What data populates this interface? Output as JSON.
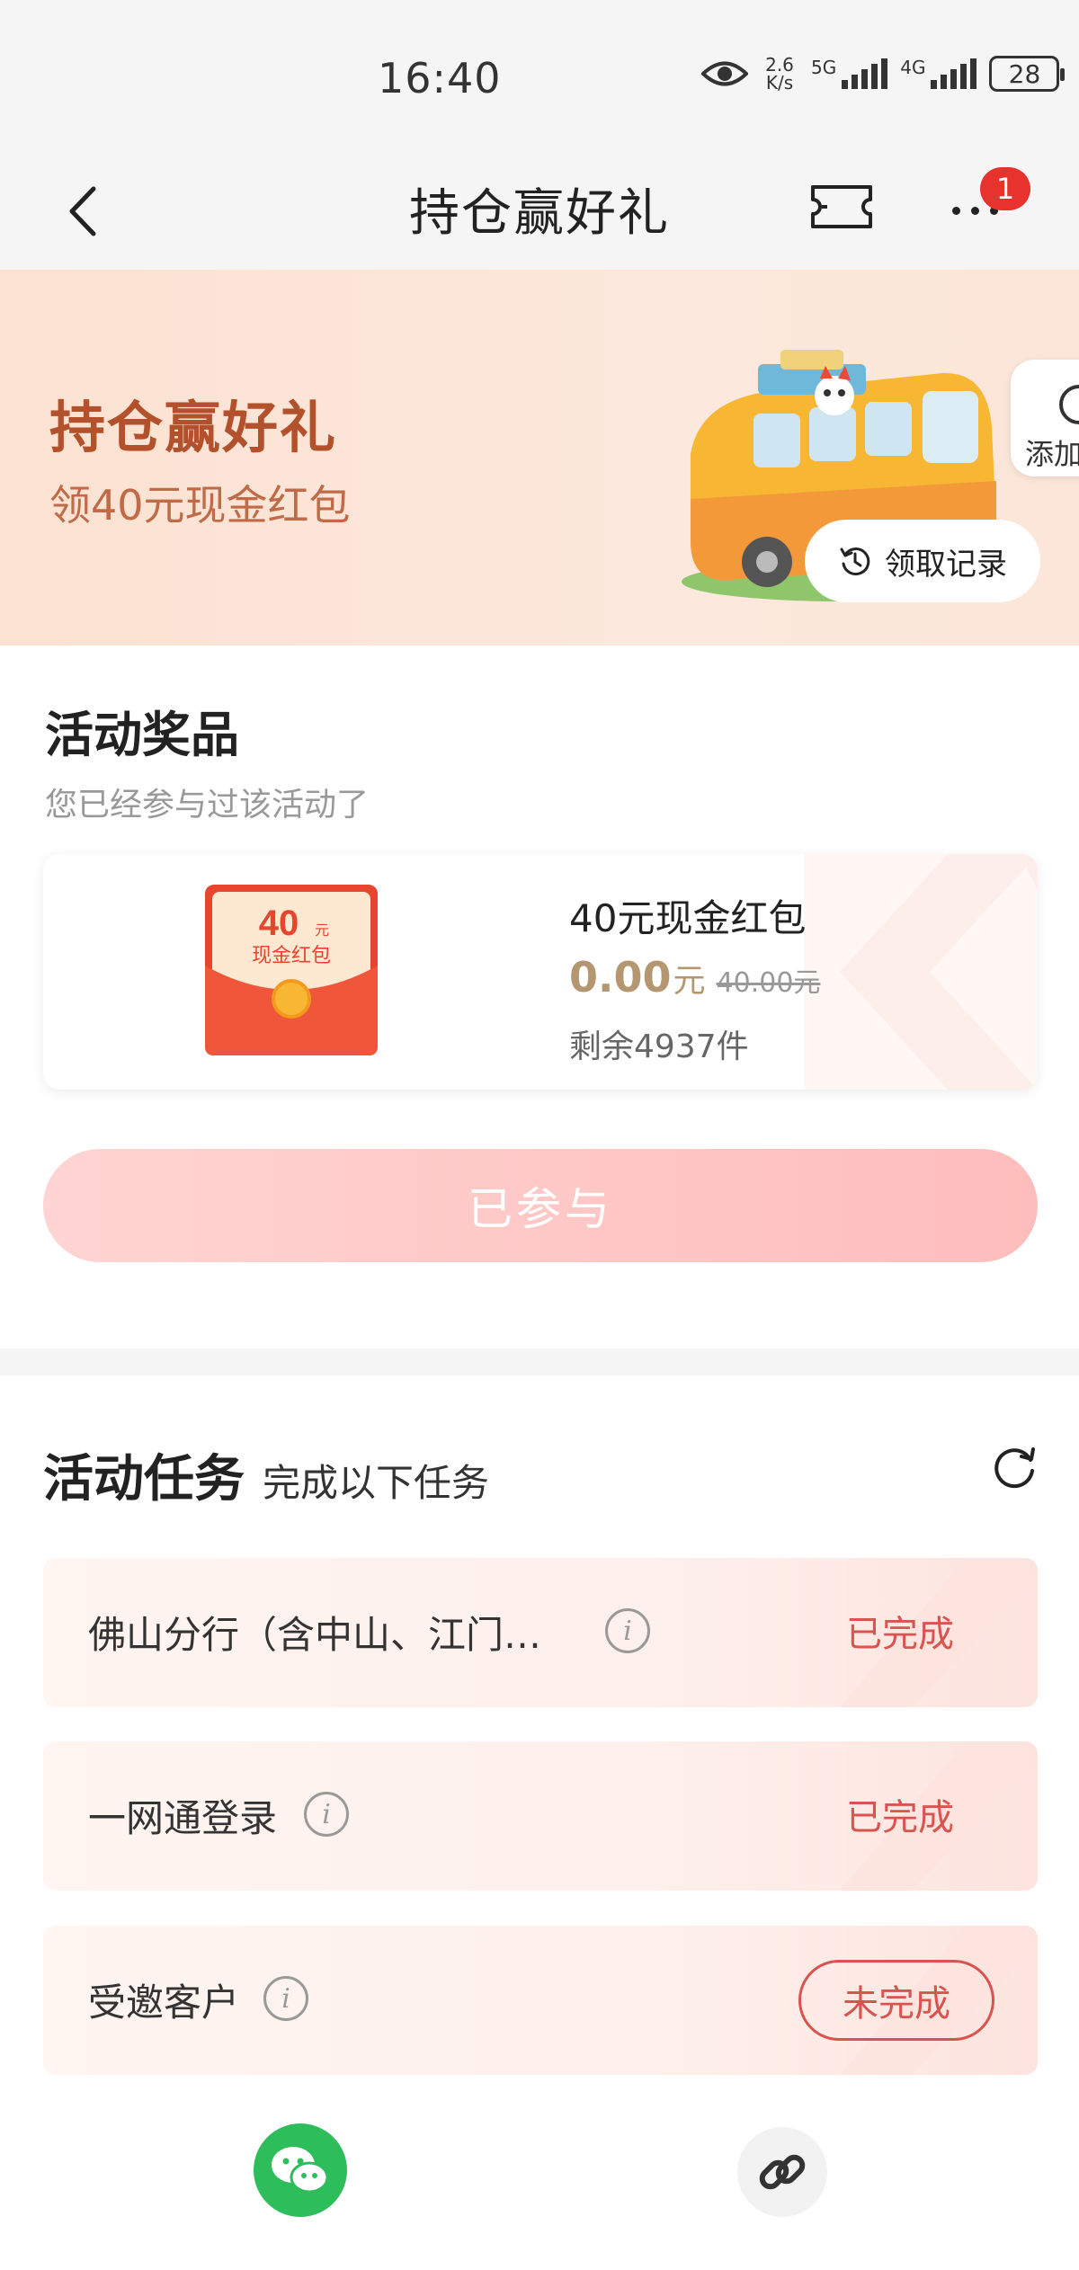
{
  "status_bar": {
    "time": "16:40",
    "net_speed_top": "2.6",
    "net_speed_bottom": "K/s",
    "signal1_label": "5G",
    "signal2_label": "4G",
    "battery": "28"
  },
  "nav": {
    "title": "持仓赢好礼",
    "badge_count": "1"
  },
  "banner": {
    "title": "持仓赢好礼",
    "subtitle": "领40元现金红包",
    "add_label": "添加",
    "record_button": "领取记录"
  },
  "prize": {
    "section_title": "活动奖品",
    "note": "您已经参与过该活动了",
    "envelope_amount": "40",
    "envelope_unit": "元",
    "envelope_label": "现金红包",
    "name": "40元现金红包",
    "price": "0.00",
    "price_unit": "元",
    "original_price": "40.00元",
    "stock": "剩余4937件",
    "button": "已参与"
  },
  "tasks": {
    "title": "活动任务",
    "subtitle": "完成以下任务",
    "items": [
      {
        "name": "佛山分行（含中山、江门…",
        "status": "已完成"
      },
      {
        "name": "一网通登录",
        "status": "已完成"
      },
      {
        "name": "受邀客户",
        "status": "未完成"
      }
    ]
  },
  "colors": {
    "brand_red": "#d9534f",
    "banner_title": "#b2512b",
    "price_gold": "#b49770",
    "wechat_green": "#2ebd5b"
  },
  "icons": {
    "back": "chevron-left-icon",
    "ticket": "ticket-icon",
    "more": "more-dots-icon",
    "refresh": "refresh-icon",
    "wechat": "wechat-icon",
    "link": "link-icon"
  }
}
